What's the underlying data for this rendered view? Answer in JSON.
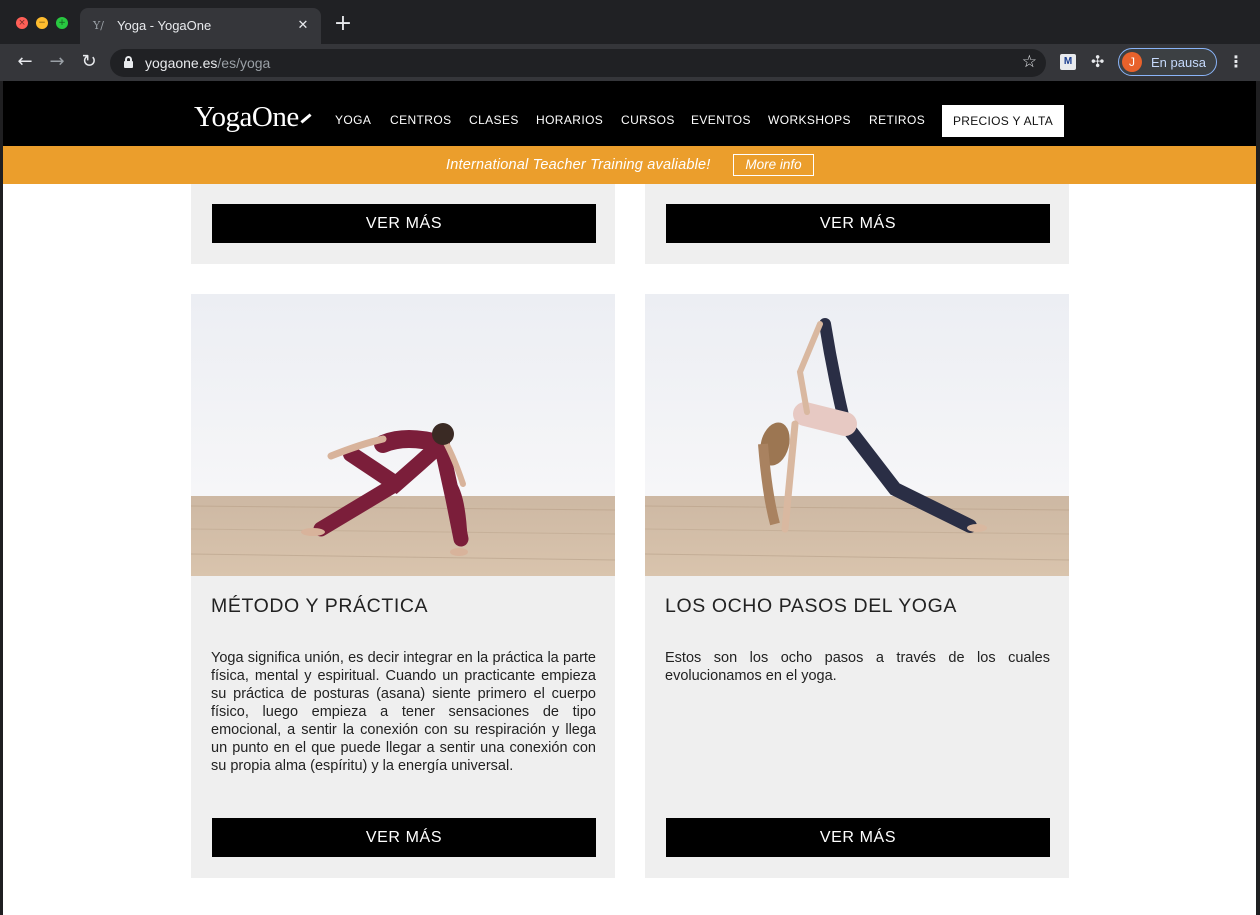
{
  "browser": {
    "tab_title": "Yoga - YogaOne",
    "tab_close": "✕",
    "new_tab": "+",
    "url_host": "yogaone.es",
    "url_path": "/es/yoga",
    "profile_initial": "J",
    "profile_status": "En pausa",
    "extension_label": "M"
  },
  "site": {
    "logo_text": "YogaOne",
    "nav": [
      "YOGA",
      "CENTROS",
      "CLASES",
      "HORARIOS",
      "CURSOS",
      "EVENTOS",
      "WORKSHOPS",
      "RETIROS"
    ],
    "cta_label": "PRECIOS Y ALTA",
    "promo_text": "International Teacher Training avaliable!",
    "promo_button": "More info"
  },
  "cards_top": [
    {
      "button": "VER MÁS"
    },
    {
      "button": "VER MÁS"
    }
  ],
  "cards": [
    {
      "title": "MÉTODO Y PRÁCTICA",
      "text": "Yoga significa unión, es decir integrar en la práctica la parte física, mental y espiritual. Cuando un practicante empieza su práctica de posturas (asana) siente primero el cuerpo físico, luego empieza a tener sensaciones de tipo emocional, a sentir la conexión con su respiración y llega un punto en el que puede llegar a sentir una conexión con su propia alma (espíritu) y la energía universal.",
      "button": "VER MÁS"
    },
    {
      "title": "LOS OCHO PASOS DEL YOGA",
      "text": "Estos son los ocho pasos a través de los cuales evolucionamos en el yoga.",
      "button": "VER MÁS"
    }
  ],
  "colors": {
    "promo_bar": "#eb9e2c",
    "header": "#000000",
    "card_bg": "#efefef"
  }
}
